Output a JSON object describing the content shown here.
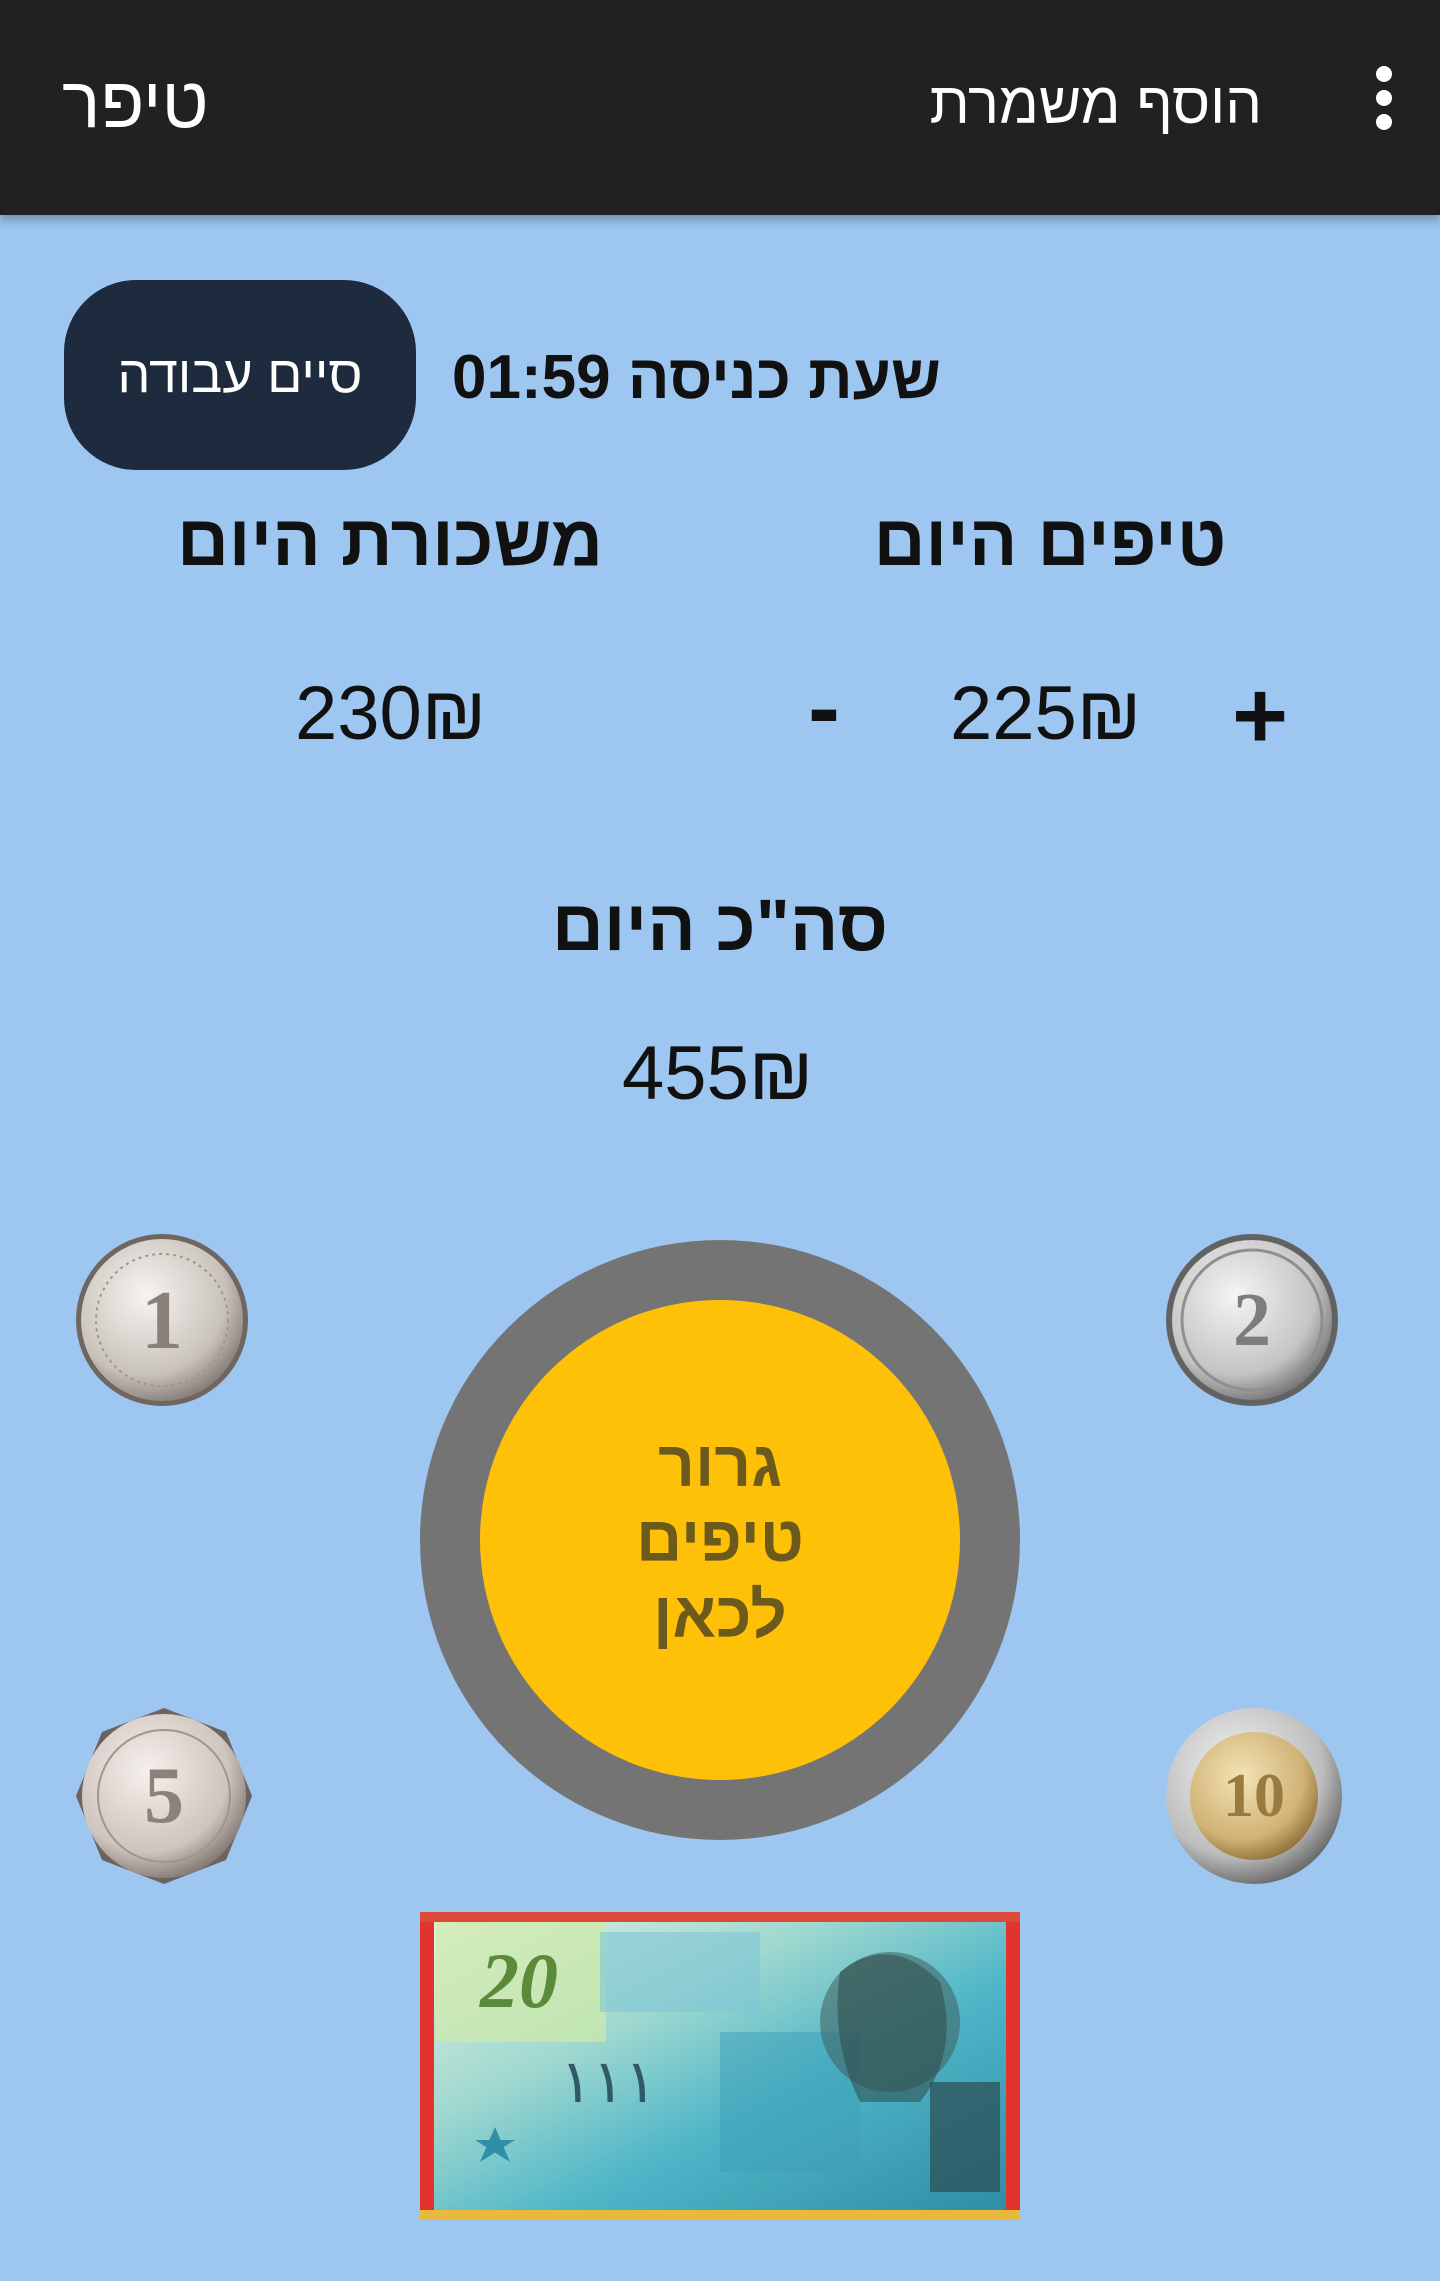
{
  "appbar": {
    "title": "טיפר",
    "add_shift_label": "הוסף משמרת",
    "menu_icon": "more-vert-icon"
  },
  "shift": {
    "end_work_label": "סיים עבודה",
    "entry_time_label": "שעת כניסה 01:59"
  },
  "summary": {
    "tips_heading": "טיפים היום",
    "salary_heading": "משכורת היום",
    "tips_value": "225₪",
    "salary_value": "230₪",
    "plus_label": "+",
    "minus_label": "-",
    "total_heading": "סה\"כ היום",
    "total_value": "455₪"
  },
  "drop_zone": {
    "label": "גרור טיפים לכאן"
  },
  "coins": {
    "one": {
      "numeral": "1"
    },
    "two": {
      "numeral": "2"
    },
    "five": {
      "numeral": "5"
    },
    "ten": {
      "numeral": "10"
    }
  },
  "banknote": {
    "denomination": "20"
  },
  "colors": {
    "appbar": "#212121",
    "background": "#9dc6f1",
    "end_button": "#1e2a3e",
    "drop_ring": "#747474",
    "drop_fill": "#ffc107"
  }
}
